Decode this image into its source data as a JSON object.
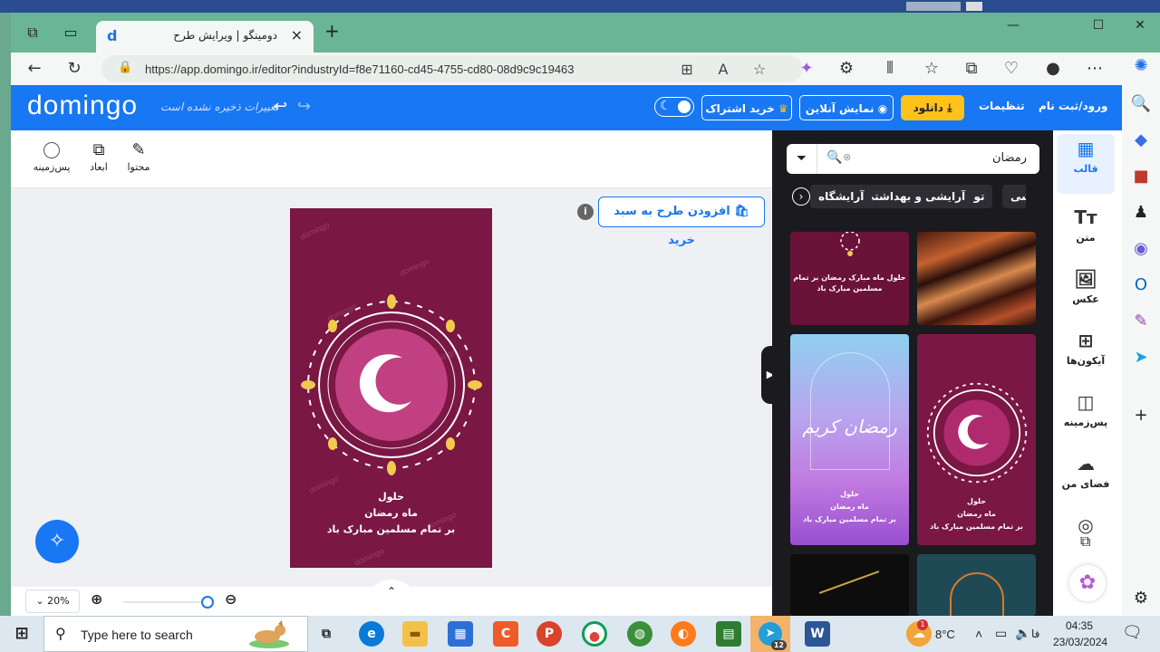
{
  "browser": {
    "tab_title": "دومینگو | ویرایش طرح",
    "url": "https://app.domingo.ir/editor?industryId=f8e71160-cd45-4755-cd80-08d9c9c19463"
  },
  "app": {
    "logo": "domingo",
    "save_state": "تغییرات ذخیره نشده است",
    "header": {
      "buy_subscription": "خرید اشتراک",
      "online_preview": "نمایش آنلاین",
      "download": "دانلود",
      "settings": "تنظیمات",
      "login": "ورود/ثبت نام"
    },
    "toolbar": {
      "background": "پس‌زمینه",
      "dimensions": "ابعاد",
      "content": "محتوا"
    },
    "canvas": {
      "add_to_cart": "افزودن طرح به سبد خرید",
      "watermark": "domingo",
      "design_lines": [
        "حلول",
        "ماه رمضان",
        "بر تمام مسلمین مبارک باد"
      ],
      "zoom": "20%"
    },
    "panel": {
      "search_value": "رمضان",
      "chips": [
        "شی",
        "تولد",
        "آرایشی و بهداشتی",
        "آرایشگاه"
      ],
      "tpl1_lines": [
        "حلول ماه مبارک رمضان بر تمام",
        "مسلمین مبارک باد"
      ],
      "tpl3_title": "رمضان کریم",
      "tpl3_lines": [
        "حلول",
        "ماه رمضان",
        "بر تمام مسلمین مبارک باد"
      ],
      "tpl4_lines": [
        "حلول",
        "ماه رمضان",
        "بر تمام مسلمین مبارک باد"
      ]
    },
    "rail": [
      "قالب",
      "متن",
      "عکس",
      "آیکون‌ها",
      "پس‌زمینه",
      "فضای من"
    ]
  },
  "taskbar": {
    "search_placeholder": "Type here to search",
    "weather": "8°C",
    "weather_badge": "1",
    "lang": "فا",
    "time": "04:35",
    "date": "23/03/2024",
    "telegram_badge": "12"
  },
  "colors": {
    "brand": "#1877f2",
    "design_bg": "#7a1744",
    "download_btn": "#ffc21a",
    "browser_frame": "#6ab594"
  }
}
